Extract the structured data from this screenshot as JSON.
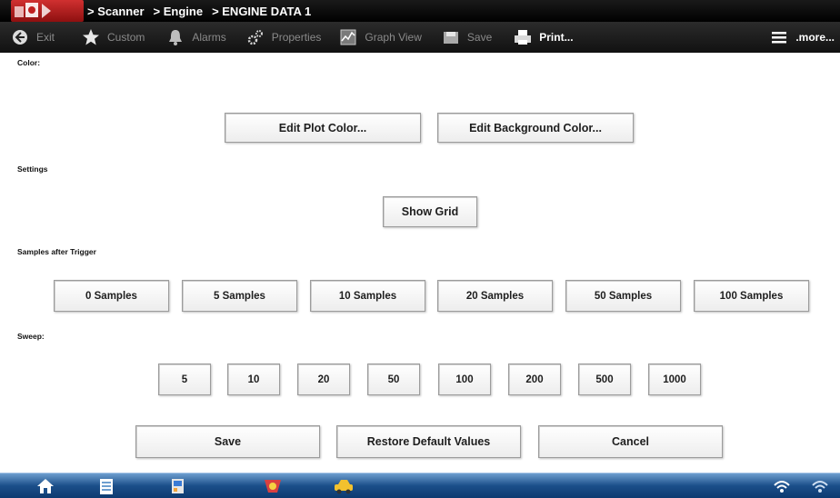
{
  "titlebar": {
    "crumbs": [
      "> Scanner",
      "> Engine",
      "> ENGINE DATA 1"
    ]
  },
  "toolbar": {
    "exit": "Exit",
    "custom": "Custom",
    "alarms": "Alarms",
    "properties": "Properties",
    "graph_view": "Graph View",
    "save": "Save",
    "print": "Print...",
    "more": ".more..."
  },
  "sections": {
    "color": "Color:",
    "settings": "Settings",
    "samples": "Samples after Trigger",
    "sweep": "Sweep:"
  },
  "color_buttons": {
    "plot": "Edit Plot Color...",
    "background": "Edit Background Color..."
  },
  "settings_buttons": {
    "show_grid": "Show Grid"
  },
  "samples_buttons": [
    "0 Samples",
    "5 Samples",
    "10 Samples",
    "20 Samples",
    "50 Samples",
    "100 Samples"
  ],
  "sweep_buttons": [
    "5",
    "10",
    "20",
    "50",
    "100",
    "200",
    "500",
    "1000"
  ],
  "actions": {
    "save": "Save",
    "restore": "Restore Default Values",
    "cancel": "Cancel"
  },
  "icons": {
    "toolbar": [
      "back-arrow-icon",
      "star-icon",
      "bell-icon",
      "gear-icon",
      "graph-icon",
      "disk-icon",
      "printer-icon",
      "menu-lines-icon"
    ],
    "taskbar": [
      "home-icon",
      "document-icon",
      "scanner-icon",
      "tool-icon",
      "car-icon",
      "wifi-icon",
      "signal-icon"
    ]
  },
  "colors": {
    "titlebar": "#000000",
    "toolbar": "#1f1f1f",
    "taskbar": "#1b4f8a",
    "button_border": "#9c9c9c"
  }
}
